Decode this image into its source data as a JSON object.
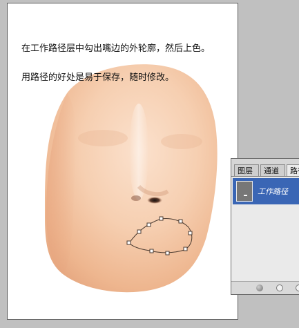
{
  "caption": {
    "line1": "在工作路径层中勾出嘴边的外轮廓，然后上色。",
    "line2": "用路径的好处是易于保存，随时修改。"
  },
  "panel": {
    "tabs": [
      "图层",
      "通道",
      "路径"
    ],
    "active_tab": "路径",
    "rows": [
      {
        "label": "工作路径",
        "selected": true
      }
    ],
    "buttons": [
      "fill-path-icon",
      "stroke-path-icon",
      "load-selection-icon"
    ]
  },
  "colors": {
    "skin_light": "#f7d2b6",
    "skin_mid": "#efb690",
    "skin_shadow": "#e2a27c",
    "selection_blue": "#3a66b5"
  }
}
